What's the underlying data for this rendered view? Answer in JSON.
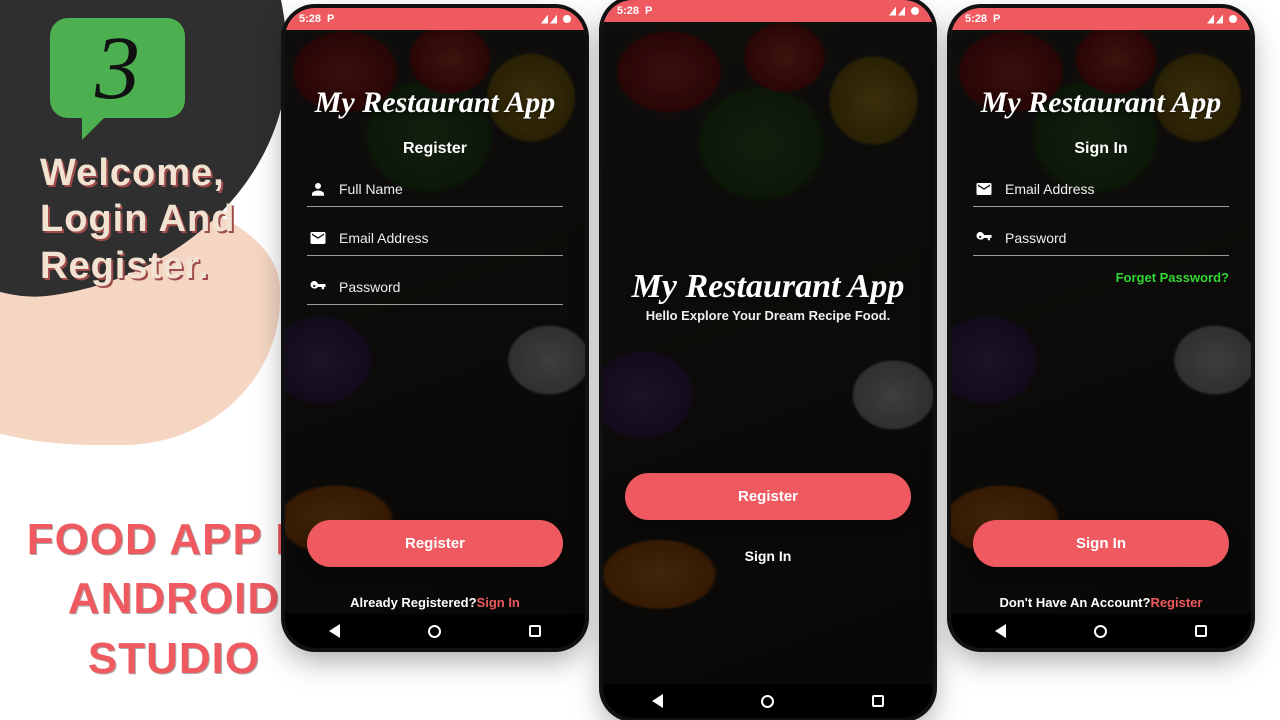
{
  "banner": {
    "bubble_number": "3",
    "welcome_lines": "Welcome,\nLogin And\nRegister.",
    "bottom_title": "FOOD APP\nIN\nANDROID STUDIO"
  },
  "status_bar": {
    "time": "5:28",
    "icon_label": "P"
  },
  "app_title": "My Restaurant App",
  "screens": {
    "register": {
      "section_title": "Register",
      "fields": {
        "name_placeholder": "Full Name",
        "email_placeholder": "Email Address",
        "password_placeholder": "Password"
      },
      "button_label": "Register",
      "footer_plain": "Already Registered?",
      "footer_action": "Sign In"
    },
    "welcome": {
      "subtitle": "Hello Explore Your Dream Recipe Food.",
      "button_label": "Register",
      "secondary_action": "Sign In"
    },
    "login": {
      "section_title": "Sign In",
      "fields": {
        "email_placeholder": "Email Address",
        "password_placeholder": "Password"
      },
      "forgot_label": "Forget Password?",
      "button_label": "Sign In",
      "footer_plain": "Don't Have An Account?",
      "footer_action": "Register"
    }
  }
}
